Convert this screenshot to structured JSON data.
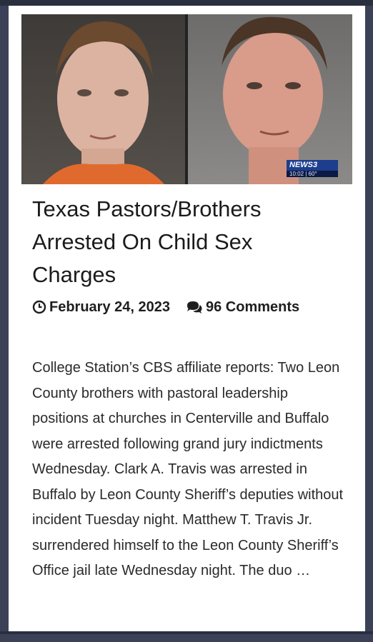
{
  "article": {
    "title": "Texas Pastors/Brothers Arrested On Child Sex Charges",
    "date": "February 24, 2023",
    "comments": "96 Comments",
    "excerpt": "College Station’s CBS affiliate reports: Two Leon County brothers with pastoral leadership positions at churches in Centerville and Buffalo were arrested following grand jury indictments Wednesday. Clark A. Travis was arrested in Buffalo by Leon County Sheriff’s deputies without incident Tuesday night. Matthew T. Travis Jr. surrendered himself to the Leon County Sheriff’s Office jail late Wednesday night. The duo …"
  },
  "photo": {
    "badge_brand": "NEWS",
    "badge_channel": "3",
    "badge_info": "10:02 | 60°"
  },
  "icons": {
    "clock": "clock-icon",
    "comments": "comments-icon"
  }
}
